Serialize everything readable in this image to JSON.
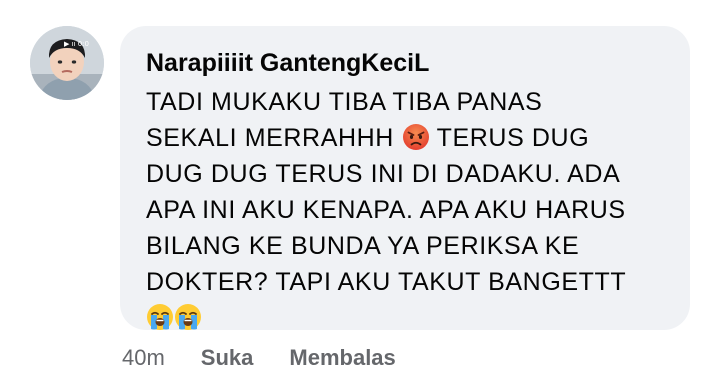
{
  "comment": {
    "author": "Narapiiiit GantengKeciL",
    "lines": [
      "TADI MUKAKU TIBA TIBA PANAS",
      "SEKALI MERRAHHH",
      "TERUS DUG",
      "DUG DUG TERUS INI DI DADAKU. ADA",
      "APA INI AKU KENAPA. APA AKU HARUS",
      "BILANG KE BUNDA YA PERIKSA KE",
      "DOKTER? TAPI AKU TAKUT BANGETTT"
    ],
    "emojis": [
      "angry-face-emoji",
      "loudly-crying-face-emoji",
      "loudly-crying-face-emoji"
    ]
  },
  "actions": {
    "time": "40m",
    "like_label": "Suka",
    "reply_label": "Membalas"
  },
  "avatar": {
    "icon": "profile-avatar",
    "overlay_text": "▶ ıı 0:0"
  }
}
